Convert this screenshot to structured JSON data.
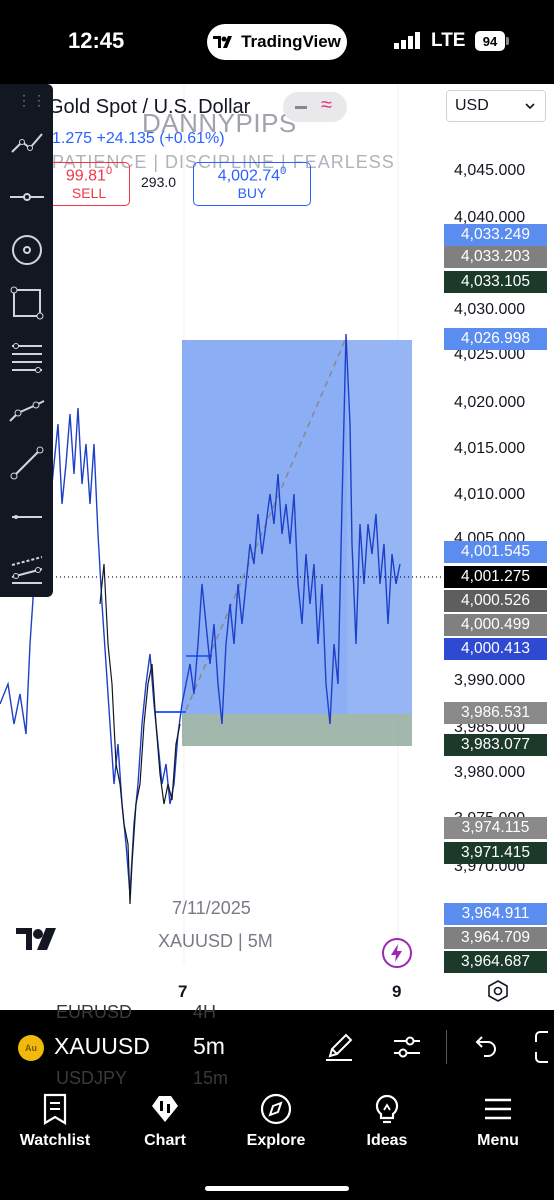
{
  "status_bar": {
    "time": "12:45",
    "app_name": "TradingView",
    "network": "LTE",
    "battery": "94"
  },
  "header": {
    "symbol_title": "Gold Spot / U.S. Dollar",
    "change": "1.275 +24.135 (+0.61%)",
    "watermark_title": "DANNYPIPS",
    "watermark_subtitle": "PATIENCE | DISCIPLINE | FEARLESS",
    "sell_price": "99.81",
    "sell_price_sup": "0",
    "sell_label": "SELL",
    "spread": "293.0",
    "buy_price": "4,002.74",
    "buy_price_sup": "0",
    "buy_label": "BUY",
    "currency": "USD"
  },
  "price_axis": {
    "labels": [
      "4,045.000",
      "4,040.000",
      "4,030.000",
      "4,025.000",
      "4,020.000",
      "4,015.000",
      "4,010.000",
      "4,005.000",
      "3,990.000",
      "3,985.000",
      "3,980.000",
      "3,975.000",
      "3,970.000"
    ],
    "tags": [
      {
        "value": "4,033.249",
        "color": "#5b8cf0"
      },
      {
        "value": "4,033.203",
        "color": "#808080"
      },
      {
        "value": "4,033.105",
        "color": "#1b3a2a"
      },
      {
        "value": "4,026.998",
        "color": "#5b8cf0"
      },
      {
        "value": "4,001.545",
        "color": "#5b8cf0"
      },
      {
        "value": "4,001.275",
        "color": "#000000"
      },
      {
        "value": "4,000.526",
        "color": "#5e5e5e"
      },
      {
        "value": "4,000.499",
        "color": "#808080"
      },
      {
        "value": "4,000.413",
        "color": "#2f49d1"
      },
      {
        "value": "3,986.531",
        "color": "#8a8a8a"
      },
      {
        "value": "3,983.077",
        "color": "#1b3a2a"
      },
      {
        "value": "3,974.115",
        "color": "#8a8a8a"
      },
      {
        "value": "3,971.415",
        "color": "#1b3a2a"
      },
      {
        "value": "3,964.911",
        "color": "#5b8cf0"
      },
      {
        "value": "3,964.709",
        "color": "#808080"
      },
      {
        "value": "3,964.687",
        "color": "#1b3a2a"
      }
    ]
  },
  "chart_footer": {
    "date": "7/11/2025",
    "symbol_interval": "XAUUSD | 5M",
    "x_labels": [
      "7",
      "9"
    ]
  },
  "symbol_bar": {
    "symbol": "XAUUSD",
    "interval": "5m",
    "ghost_above_symbol": "EURUSD",
    "ghost_above_interval": "4H",
    "ghost_below_symbol": "USDJPY",
    "ghost_below_interval": "15m"
  },
  "bottom_nav": [
    {
      "label": "Watchlist"
    },
    {
      "label": "Chart"
    },
    {
      "label": "Explore"
    },
    {
      "label": "Ideas"
    },
    {
      "label": "Menu"
    }
  ],
  "colors": {
    "up": "#2962ff",
    "down": "#131722",
    "position_target": "#5b8cf0",
    "position_stop": "#7a9a8a"
  }
}
